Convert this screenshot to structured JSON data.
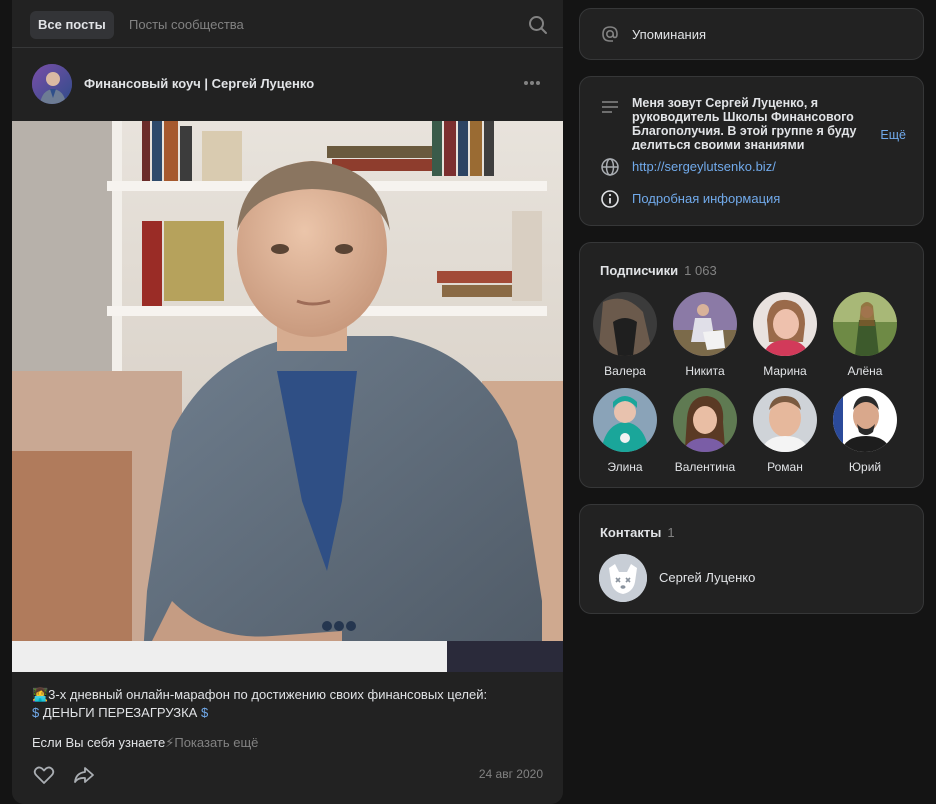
{
  "feed": {
    "tabs": [
      "Все посты",
      "Посты сообщества"
    ],
    "post": {
      "author": "Финансовый коуч | Сергей Луценко",
      "text_line1": "👩‍💻3-х дневный онлайн-марафон по достижению своих финансовых целей:",
      "text_line2_prefix": "$ ",
      "text_line2_main": "ДЕНЬГИ ПЕРЕЗАГРУЗКА",
      "text_line2_suffix": " $",
      "more_text": "Если Вы себя узнаете",
      "show_more": "⚡Показать ещё",
      "date": "24 авг 2020"
    }
  },
  "sidebar": {
    "mentions_label": "Упоминания",
    "about": {
      "description": "Меня зовут Сергей Луценко, я руководитель Школы Финансового Благополучия. В этой группе я буду делиться своими знаниями",
      "more": "Ещё",
      "link": "http://sergeylutsenko.biz/",
      "info": "Подробная информация"
    },
    "subscribers": {
      "title": "Подписчики",
      "count": "1 063",
      "items": [
        {
          "name": "Валера"
        },
        {
          "name": "Никита"
        },
        {
          "name": "Марина"
        },
        {
          "name": "Алёна"
        },
        {
          "name": "Элина"
        },
        {
          "name": "Валентина"
        },
        {
          "name": "Роман"
        },
        {
          "name": "Юрий"
        }
      ]
    },
    "contacts": {
      "title": "Контакты",
      "count": "1",
      "name": "Сергей Луценко"
    }
  },
  "colors": {
    "background": "#141414",
    "card": "#222222",
    "border": "#363738",
    "text": "#e1e3e6",
    "muted": "#828282",
    "link": "#71aaeb"
  }
}
